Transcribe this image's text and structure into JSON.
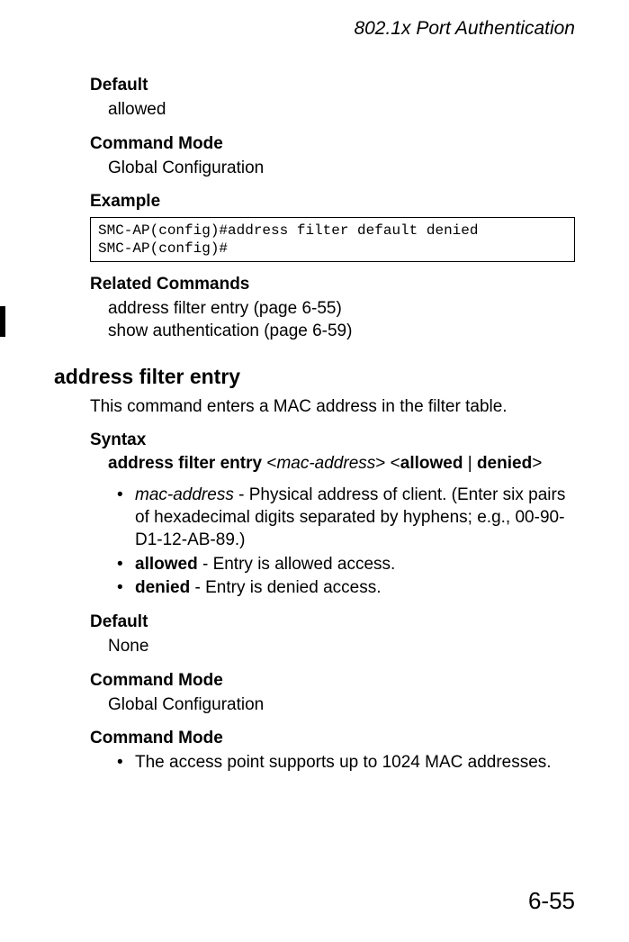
{
  "header": {
    "running_title": "802.1x Port Authentication"
  },
  "section1": {
    "default_heading": "Default",
    "default_value": "allowed",
    "command_mode_heading": "Command Mode",
    "command_mode_value": "Global Configuration",
    "example_heading": "Example",
    "example_code": "SMC-AP(config)#address filter default denied\nSMC-AP(config)#",
    "related_heading": "Related Commands",
    "related_line1": "address filter entry (page 6-55)",
    "related_line2": "show authentication (page 6-59)"
  },
  "section2": {
    "command_title": "address filter entry",
    "intro_text": "This command enters a MAC address in the filter table.",
    "syntax_heading": "Syntax",
    "syntax": {
      "cmd": "address filter entry",
      "lt1": " <",
      "arg": "mac-address",
      "gt1": "> <",
      "opt1": "allowed",
      "pipe": " | ",
      "opt2": "denied",
      "gt2": ">"
    },
    "bullets1": {
      "b1_italic": "mac-address",
      "b1_rest": " - Physical address of client. (Enter six pairs of hexadecimal digits separated by hyphens; e.g., 00-90-D1-12-AB-89.)",
      "b2_bold": "allowed",
      "b2_rest": " - Entry is allowed access.",
      "b3_bold": "denied",
      "b3_rest": " - Entry is denied access."
    },
    "default_heading": "Default",
    "default_value": "None",
    "command_mode_heading": "Command Mode",
    "command_mode_value": "Global Configuration",
    "command_mode_heading2": "Command Mode",
    "notes": {
      "n1": "The access point supports up to 1024 MAC addresses."
    }
  },
  "footer": {
    "page_number": "6-55"
  }
}
